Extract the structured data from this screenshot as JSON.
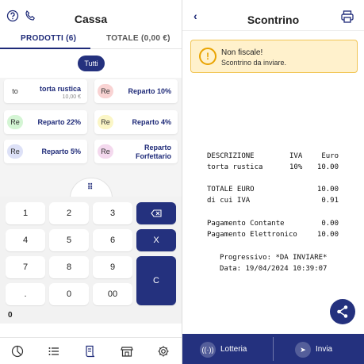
{
  "left": {
    "title": "Cassa",
    "tabs": [
      {
        "label": "PRODOTTI (6)"
      },
      {
        "label": "TOTALE (0,00 €)"
      }
    ],
    "filter_label": "Tutti",
    "cards": [
      {
        "badge": "to",
        "name": "torta rustica",
        "price": "10,00 €",
        "badge_color": "#ffffff"
      },
      {
        "badge": "Re",
        "name": "Reparto 10%",
        "price": "",
        "badge_color": "#f9d3d3"
      },
      {
        "badge": "Re",
        "name": "Reparto 22%",
        "price": "",
        "badge_color": "#d4f5d4"
      },
      {
        "badge": "Re",
        "name": "Reparto 4%",
        "price": "",
        "badge_color": "#fbf6c6"
      },
      {
        "badge": "Re",
        "name": "Reparto 5%",
        "price": "",
        "badge_color": "#dde1f7"
      },
      {
        "badge": "Re",
        "name_line1": "Reparto",
        "name_line2": "Forfettario",
        "price": "",
        "badge_color": "#f4d9ee"
      }
    ],
    "keys": {
      "k1": "1",
      "k2": "2",
      "k3": "3",
      "k4": "4",
      "k5": "5",
      "k6": "6",
      "k7": "7",
      "k8": "8",
      "k9": "9",
      "kdot": ".",
      "k0": "0",
      "k00": "00",
      "multiply": "X",
      "clear": "C"
    },
    "display_value": "0",
    "nav_icons": [
      "chart-pie-icon",
      "list-icon",
      "receipt-icon",
      "store-icon",
      "gear-icon"
    ]
  },
  "right": {
    "title": "Scontrino",
    "alert": {
      "title": "Non fiscale!",
      "message": "Scontrino da inviare.",
      "icon": "!"
    },
    "receipt": {
      "header": {
        "desc": "DESCRIZIONE",
        "iva": "IVA",
        "euro": "Euro"
      },
      "item": {
        "desc": "torta rustica",
        "iva": "10%",
        "euro": "10.00"
      },
      "totale_label": "TOTALE EURO",
      "totale_value": "10.00",
      "iva_label": "di cui IVA",
      "iva_value": "0.91",
      "contante_label": "Pagamento Contante",
      "contante_value": "0.00",
      "elettronico_label": "Pagamento Elettronico",
      "elettronico_value": "10.00",
      "progressivo": "Progressivo: *DA INVIARE*",
      "data": "Data: 19/04/2024 10:39:07"
    },
    "footer": {
      "lotteria": "Lotteria",
      "invia": "Invia"
    }
  },
  "colors": {
    "accent": "#24317e",
    "alert_bg": "#fff1cc",
    "alert_border": "#f1c453"
  }
}
